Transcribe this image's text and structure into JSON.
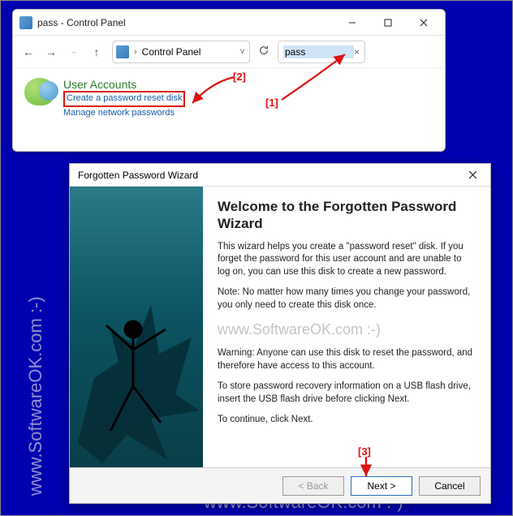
{
  "watermark": {
    "vertical": "www.SoftwareOK.com :-)",
    "bottom": "www.SoftwareOK.com :-)",
    "inline": "www.SoftwareOK.com :-)"
  },
  "control_panel": {
    "title": "pass - Control Panel",
    "win_buttons": {
      "min": "minimize",
      "max": "maximize",
      "close": "close"
    },
    "toolbar": {
      "back": "←",
      "forward": "→",
      "up": "↑",
      "chevron_sep": "›",
      "breadcrumb_icon": "control-panel",
      "breadcrumb_text": "Control Panel",
      "dropdown": "v",
      "refresh": "refresh",
      "search_value": "pass",
      "search_clear": "×"
    },
    "body": {
      "section_title": "User Accounts",
      "link_reset_disk": "Create a password reset disk",
      "link_network_pw": "Manage network passwords"
    }
  },
  "wizard": {
    "title": "Forgotten Password Wizard",
    "heading": "Welcome to the Forgotten Password Wizard",
    "p1": "This wizard helps you create a \"password reset\" disk. If you forget the password for this user account and are unable to log on, you can use this disk to create a new password.",
    "p2": "Note: No matter how many times you change your password, you only need to create this disk once.",
    "p3": "Warning: Anyone can use this disk to reset the password, and therefore have access to this account.",
    "p4": "To store password recovery information on a USB flash drive, insert the USB flash drive before clicking Next.",
    "p5": "To continue, click Next.",
    "buttons": {
      "back": "< Back",
      "next": "Next >",
      "cancel": "Cancel"
    }
  },
  "annotations": {
    "a1": "[1]",
    "a2": "[2]",
    "a3": "[3]"
  }
}
